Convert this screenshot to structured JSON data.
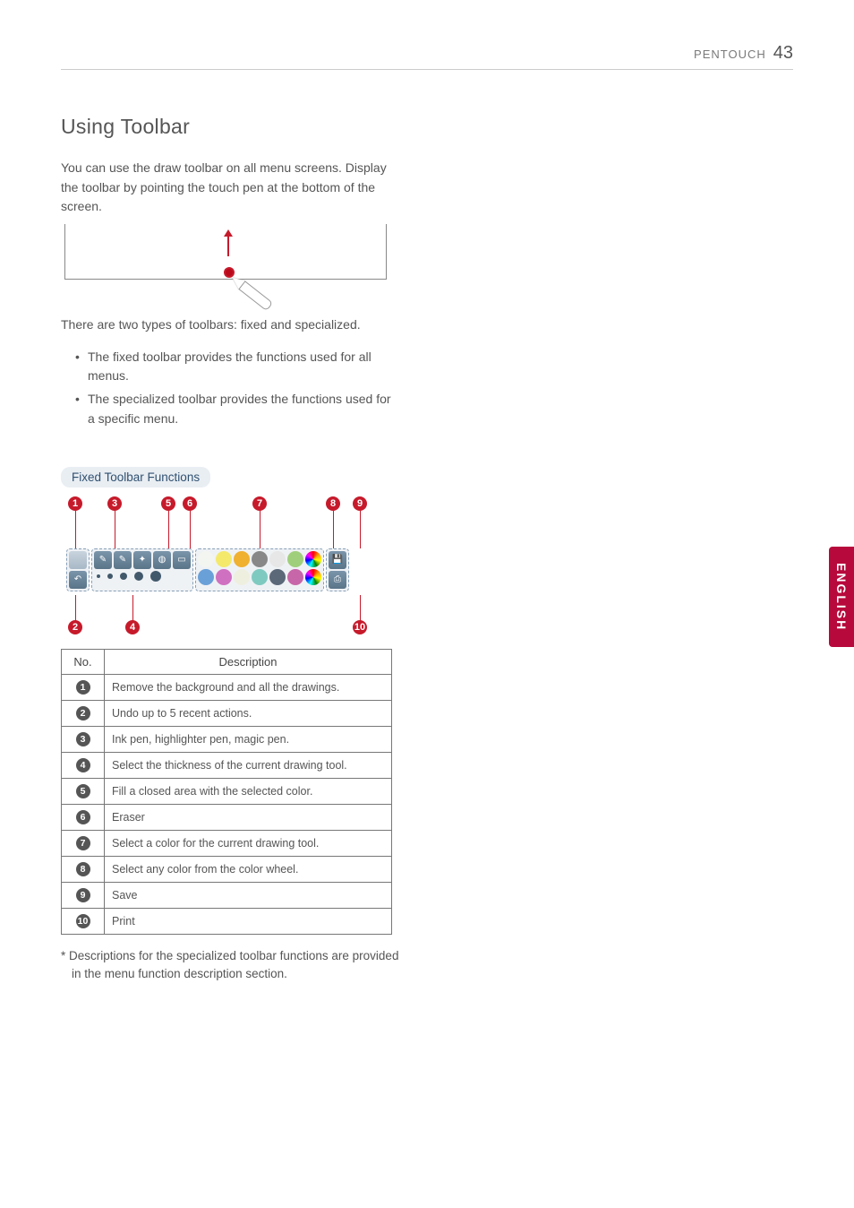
{
  "header": {
    "section": "PENTOUCH",
    "page": "43"
  },
  "title": "Using Toolbar",
  "intro": "You can use the draw toolbar on all menu screens. Display the toolbar by pointing the touch pen at the bottom of the screen.",
  "types_intro": "There are two types of toolbars: fixed and specialized.",
  "bullets": [
    "The fixed toolbar provides the functions used for all menus.",
    "The specialized toolbar provides the functions used for a specific menu."
  ],
  "subhead": "Fixed Toolbar Functions",
  "callouts": [
    "1",
    "2",
    "3",
    "4",
    "5",
    "6",
    "7",
    "8",
    "9",
    "10"
  ],
  "table": {
    "headers": {
      "no": "No.",
      "desc": "Description"
    },
    "rows": [
      {
        "n": "1",
        "d": "Remove the background and all the drawings."
      },
      {
        "n": "2",
        "d": "Undo up to 5 recent actions."
      },
      {
        "n": "3",
        "d": "Ink pen, highlighter pen, magic pen."
      },
      {
        "n": "4",
        "d": "Select the thickness of the current drawing tool."
      },
      {
        "n": "5",
        "d": "Fill a closed area with the selected color."
      },
      {
        "n": "6",
        "d": "Eraser"
      },
      {
        "n": "7",
        "d": "Select a color for the current drawing tool."
      },
      {
        "n": "8",
        "d": "Select any color from the color wheel."
      },
      {
        "n": "9",
        "d": "Save"
      },
      {
        "n": "10",
        "d": "Print"
      }
    ]
  },
  "footnote": "* Descriptions for the specialized toolbar functions are provided in the menu function description section.",
  "sidetab": "ENGLISH",
  "swatches": [
    "#f3f5f0",
    "#f4e96a",
    "#f0b030",
    "#888888",
    "#e7e7e7",
    "#9fcf7a",
    "#6aa0d8",
    "#d070c0",
    "#efefe0",
    "#7fcac0",
    "#5a6878",
    "#c766a8"
  ]
}
